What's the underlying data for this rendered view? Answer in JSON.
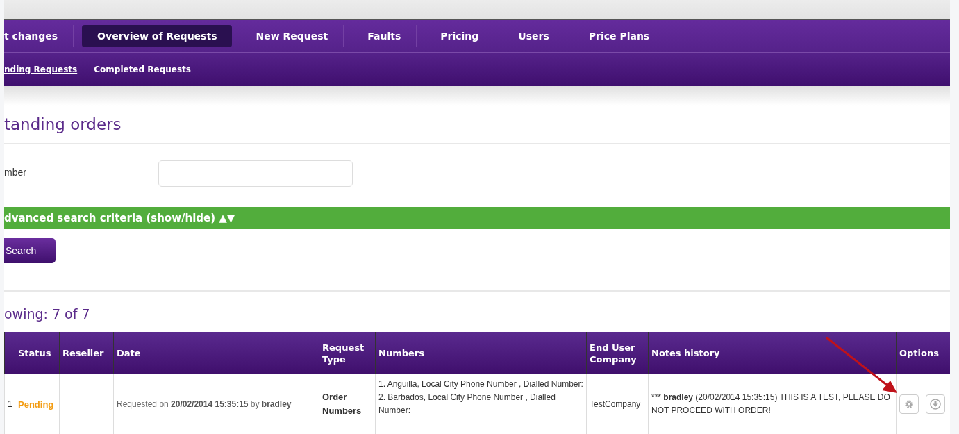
{
  "nav": {
    "tabs": [
      {
        "label": "t changes",
        "selected": false
      },
      {
        "label": "Overview of Requests",
        "selected": true
      },
      {
        "label": "New Request",
        "selected": false
      },
      {
        "label": "Faults",
        "selected": false
      },
      {
        "label": "Pricing",
        "selected": false
      },
      {
        "label": "Users",
        "selected": false
      },
      {
        "label": "Price Plans",
        "selected": false
      }
    ],
    "subtabs": [
      {
        "label": "nding Requests",
        "selected": true
      },
      {
        "label": "Completed Requests",
        "selected": false
      }
    ]
  },
  "page_title": "tanding orders",
  "search": {
    "label": "mber",
    "advanced_toggle": "dvanced search criteria (show/hide) ▲▼",
    "button": "Search"
  },
  "results_count": "owing: 7 of 7",
  "table": {
    "columns": [
      "",
      "Status",
      "Reseller",
      "Date",
      "Request Type",
      "Numbers",
      "End User Company",
      "Notes history",
      "Options"
    ],
    "rows": [
      {
        "cells": [
          {
            "kind": "text",
            "text": "1"
          },
          {
            "kind": "status",
            "text": "Pending",
            "color": "#f39c12"
          },
          {
            "kind": "empty"
          },
          {
            "kind": "date",
            "text": "Requested on **20/02/2014 15:35:15** by **bradley**"
          },
          {
            "kind": "type",
            "text": "Order Numbers"
          },
          {
            "kind": "lines",
            "lines": [
              "1. Anguilla, Local City Phone Number , Dialled Number:",
              "2. Barbados, Local City Phone Number , Dialled Number:"
            ]
          },
          {
            "kind": "text",
            "text": "TestCompany"
          },
          {
            "kind": "notes",
            "prefix": "***",
            "text": "**bradley** (20/02/2014 15:35:15) THIS IS A TEST, PLEASE DO NOT PROCEED WITH ORDER!"
          },
          {
            "kind": "options",
            "buttons": [
              {
                "kind": "settings"
              },
              {
                "kind": "download"
              }
            ]
          }
        ]
      }
    ]
  }
}
